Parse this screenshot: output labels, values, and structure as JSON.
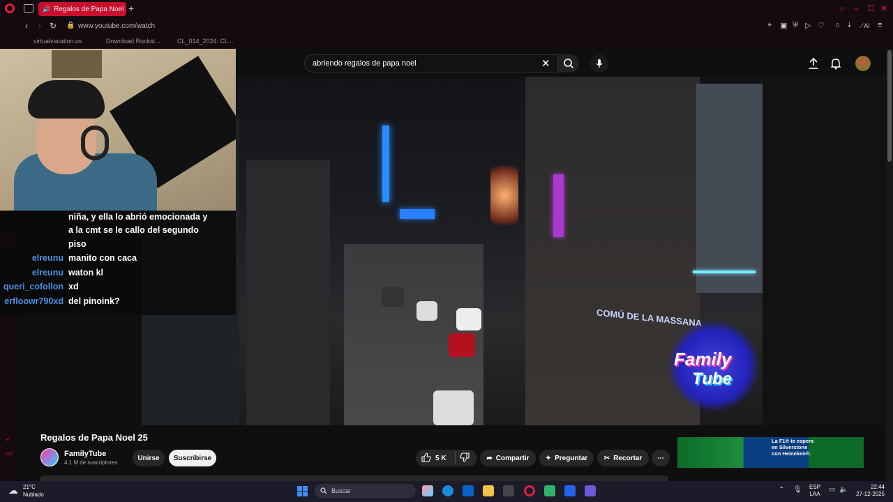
{
  "browser": {
    "tab_title": "Regalos de Papa Noel",
    "url": "www.youtube.com/watch",
    "bookmarks": [
      "virtualvacation.us",
      "Download Ruckst...",
      "CL_014_2024: CL..."
    ],
    "accent_color": "#c8102e"
  },
  "youtube": {
    "search_query": "abriendo regalos de papa noel",
    "video_title": "Regalos de Papa Noel 25",
    "channel_name": "FamilyTube",
    "subscribers": "4.1 M de suscriptores",
    "join_label": "Unirse",
    "subscribe_label": "Suscribirse",
    "like_count": "5 K",
    "share_label": "Compartir",
    "ask_label": "Preguntar",
    "clip_label": "Recortar",
    "ad_text_line1": "La F1® te espera",
    "ad_text_line2": "en Silverstone",
    "ad_text_line3": "con Heineken®.",
    "video_sign_text": "COMÚ DE LA MASSANA",
    "watermark_line1": "Family",
    "watermark_line2": "Tube"
  },
  "stream_chat": [
    {
      "user": "",
      "message": "niña, y ella lo abrió emocionada y"
    },
    {
      "user": "",
      "message": "a la cmt se le callo del segundo"
    },
    {
      "user": "",
      "message": "piso"
    },
    {
      "user": "elreunu",
      "message": "manito con caca"
    },
    {
      "user": "elreunu",
      "message": "waton kl"
    },
    {
      "user": "queri_cofollon",
      "message": "xd"
    },
    {
      "user": "erfloowr790xd",
      "message": "del pinoink?"
    }
  ],
  "taskbar": {
    "temperature": "21°C",
    "weather": "Nublado",
    "search_placeholder": "Buscar",
    "lang_line1": "ESP",
    "lang_line2": "LAA",
    "time": "22:44",
    "date": "27-12-2025"
  }
}
